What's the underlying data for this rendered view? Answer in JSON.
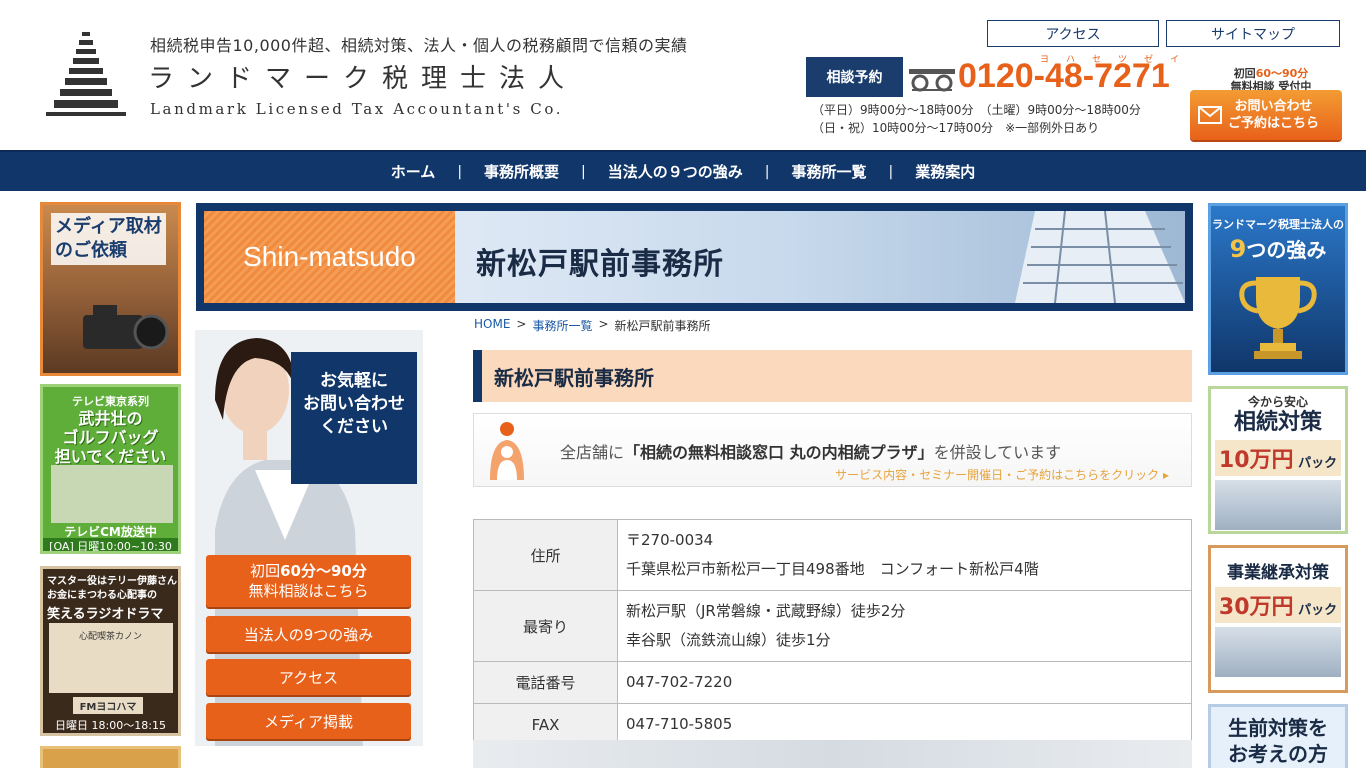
{
  "header": {
    "tagline": "相続税申告10,000件超、相続対策、法人・個人の税務顧問で信頼の実績",
    "company_jp": "ランドマーク税理士法人",
    "company_en": "Landmark Licensed Tax Accountant's Co.",
    "access_link": "アクセス",
    "sitemap_link": "サイトマップ",
    "consult_badge": "相談予約",
    "phone": "0120-48-7271",
    "phone_kana": "ヨハセツゼイ",
    "hours_line1": "（平日）9時00分～18時00分　（土曜）9時00分～18時00分",
    "hours_line2": "（日・祝）10時00分～17時00分　※一部例外日あり",
    "free_note_prefix": "初回",
    "free_note_time": "60～90分",
    "free_note_line2": "無料相談 受付中",
    "inquiry_line1": "お問い合わせ",
    "inquiry_line2": "ご予約はこちら"
  },
  "nav": {
    "items": [
      "ホーム",
      "事務所概要",
      "当法人の９つの強み",
      "事務所一覧",
      "業務案内"
    ],
    "separator": "|"
  },
  "left_sidebar": {
    "media_title_1": "メディア取材",
    "media_title_2": "のご依頼",
    "tv_series": "テレビ東京系列",
    "tv_title_1": "武井壮の",
    "tv_title_2": "ゴルフバッグ",
    "tv_title_3": "担いでください",
    "tv_cm": "テレビCM放送中",
    "tv_time": "[OA] 日曜10:00~10:30",
    "radio_line1": "マスター役はテリー伊藤さん",
    "radio_line2": "お金にまつわる心配事の",
    "radio_line3": "笑えるラジオドラマ",
    "radio_show": "心配喫茶カノン",
    "radio_station": "FMヨコハマ",
    "radio_time": "日曜日 18:00～18:15"
  },
  "main_banner": {
    "en": "Shin-matsudo",
    "jp": "新松戸駅前事務所"
  },
  "contact_panel": {
    "line1": "お気軽に",
    "line2": "お問い合わせ",
    "line3": "ください",
    "btn_free_1a": "初回",
    "btn_free_1b": "60分～90分",
    "btn_free_2": "無料相談はこちら",
    "btn_strengths": "当法人の9つの強み",
    "btn_access": "アクセス",
    "btn_media": "メディア掲載"
  },
  "breadcrumb": {
    "home": "HOME",
    "list": "事務所一覧",
    "current": "新松戸駅前事務所",
    "sep": ">"
  },
  "section_heading": "新松戸駅前事務所",
  "plaza": {
    "text_pre": "全店舗に",
    "text_bold": "「相続の無料相談窓口 丸の内相続プラザ」",
    "text_post": "を併設しています",
    "link": "サービス内容・セミナー開催日・ご予約はこちらをクリック ▸"
  },
  "info_table": {
    "rows": [
      {
        "label": "住所",
        "values": [
          "〒270-0034",
          "千葉県松戸市新松戸一丁目498番地　コンフォート新松戸4階"
        ]
      },
      {
        "label": "最寄り",
        "values": [
          "新松戸駅（JR常磐線・武蔵野線）徒歩2分",
          "幸谷駅（流鉄流山線）徒歩1分"
        ]
      },
      {
        "label": "電話番号",
        "values": [
          "047-702-7220"
        ]
      },
      {
        "label": "FAX",
        "values": [
          "047-710-5805"
        ]
      }
    ]
  },
  "right_sidebar": {
    "strengths_1": "ランドマーク税理士法人の",
    "strengths_num": "9",
    "strengths_2": "つの強み",
    "inherit_1": "今から安心",
    "inherit_2": "相続対策",
    "inherit_price": "10万円",
    "pack": "パック",
    "succession": "事業継承対策",
    "succession_price": "30万円",
    "lifetime_1": "生前対策を",
    "lifetime_2": "お考えの方"
  },
  "colors": {
    "navy": "#10366a",
    "orange": "#e8611a",
    "salmon": "#fbd9bd"
  }
}
